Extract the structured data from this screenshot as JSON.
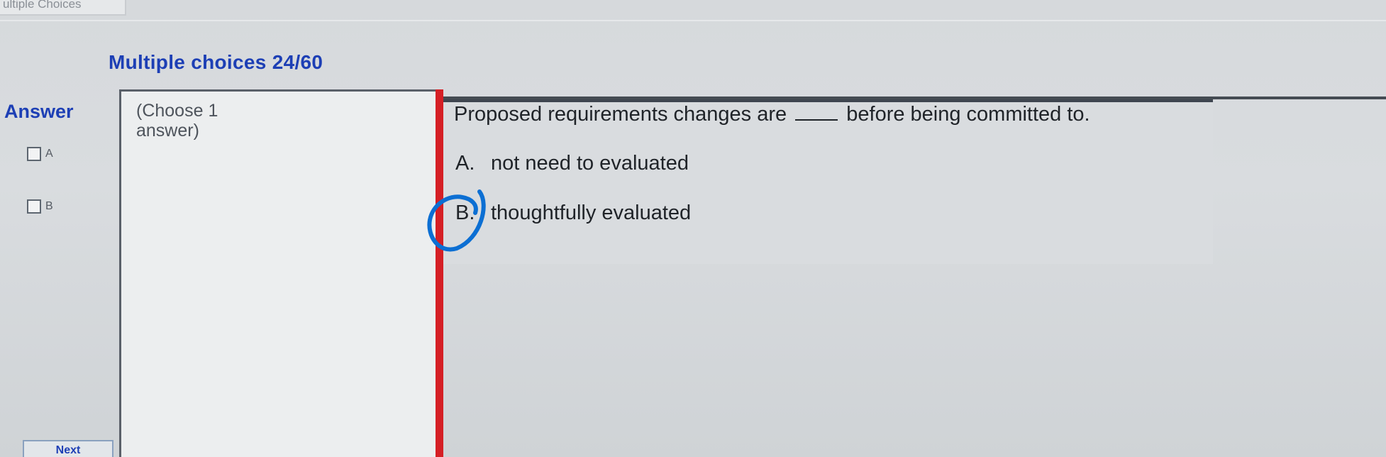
{
  "top_tab": {
    "label": "ultiple Choices"
  },
  "header": {
    "title": "Multiple choices 24/60"
  },
  "answer_panel": {
    "label": "Answer",
    "options": [
      {
        "letter": "A"
      },
      {
        "letter": "B"
      }
    ],
    "instruction": "(Choose 1 answer)"
  },
  "question": {
    "prefix": "Proposed requirements changes are",
    "suffix": "before being committed to.",
    "choices": [
      {
        "letter": "A.",
        "text": "not need to evaluated"
      },
      {
        "letter": "B.",
        "text": "thoughtfully evaluated"
      }
    ]
  },
  "footer": {
    "next_label": "Next"
  },
  "colors": {
    "title_blue": "#1d3fb5",
    "divider_red": "#d51f25",
    "mark_blue": "#0c6fd3"
  }
}
